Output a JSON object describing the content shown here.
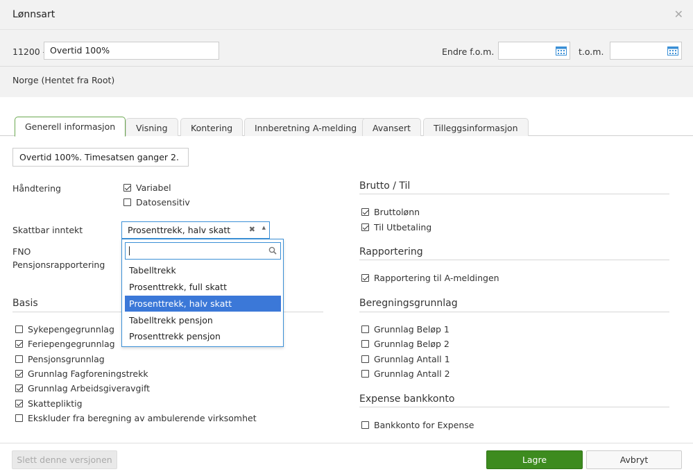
{
  "dialog": {
    "title": "Lønnsart",
    "close_icon": "close-icon"
  },
  "header": {
    "code_label": "11200 -",
    "name_value": "Overtid 100%",
    "endre_label": "Endre f.o.m.",
    "tom_label": "t.o.m.",
    "date_from_value": "",
    "date_to_value": "",
    "country": "Norge (Hentet fra Root)"
  },
  "tabs": [
    {
      "label": "Generell informasjon",
      "active": true
    },
    {
      "label": "Visning"
    },
    {
      "label": "Kontering"
    },
    {
      "label": "Innberetning A-melding"
    },
    {
      "label": "Avansert"
    },
    {
      "label": "Tilleggsinformasjon"
    }
  ],
  "general": {
    "description": "Overtid 100%. Timesatsen ganger 2.",
    "handtering_label": "Håndtering",
    "variabel_label": "Variabel",
    "variabel_checked": true,
    "datosensitiv_label": "Datosensitiv",
    "datosensitiv_checked": false,
    "skattbar_label": "Skattbar inntekt",
    "skattbar_value": "Prosenttrekk, halv skatt",
    "fno_label": "FNO",
    "pensjon_label": "Pensjonsrapportering"
  },
  "dropdown": {
    "search_value": "",
    "options": [
      {
        "label": "Tabelltrekk",
        "selected": false
      },
      {
        "label": "Prosenttrekk, full skatt",
        "selected": false
      },
      {
        "label": "Prosenttrekk, halv skatt",
        "selected": true
      },
      {
        "label": "Tabelltrekk pensjon",
        "selected": false
      },
      {
        "label": "Prosenttrekk pensjon",
        "selected": false
      }
    ]
  },
  "basis": {
    "title": "Basis",
    "items": [
      {
        "label": "Sykepengegrunnlag",
        "checked": false
      },
      {
        "label": "Feriepengegrunnlag",
        "checked": true
      },
      {
        "label": "Pensjonsgrunnlag",
        "checked": false
      },
      {
        "label": "Grunnlag Fagforeningstrekk",
        "checked": true
      },
      {
        "label": "Grunnlag Arbeidsgiveravgift",
        "checked": true
      },
      {
        "label": "Skattepliktig",
        "checked": true
      },
      {
        "label": "Ekskluder fra beregning av ambulerende virksomhet",
        "checked": false
      }
    ]
  },
  "brutto": {
    "title": "Brutto / Til",
    "items": [
      {
        "label": "Bruttolønn",
        "checked": true
      },
      {
        "label": "Til Utbetaling",
        "checked": true
      }
    ]
  },
  "rapportering": {
    "title": "Rapportering",
    "items": [
      {
        "label": "Rapportering til A-meldingen",
        "checked": true
      }
    ]
  },
  "beregning": {
    "title": "Beregningsgrunnlag",
    "items": [
      {
        "label": "Grunnlag Beløp 1",
        "checked": false
      },
      {
        "label": "Grunnlag Beløp 2",
        "checked": false
      },
      {
        "label": "Grunnlag Antall 1",
        "checked": false
      },
      {
        "label": "Grunnlag Antall 2",
        "checked": false
      }
    ]
  },
  "expense": {
    "title": "Expense bankkonto",
    "items": [
      {
        "label": "Bankkonto for Expense",
        "checked": false
      }
    ]
  },
  "footer": {
    "delete_label": "Slett denne versjonen",
    "save_label": "Lagre",
    "cancel_label": "Avbryt"
  },
  "colors": {
    "accent_green": "#3d8b1f",
    "select_blue": "#3b78d8",
    "focus_border": "#3a8fd6"
  }
}
